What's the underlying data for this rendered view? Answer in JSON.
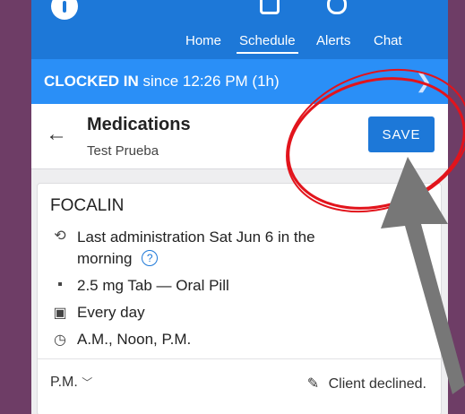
{
  "nav": {
    "tabs": [
      {
        "label": "Home"
      },
      {
        "label": "Schedule"
      },
      {
        "label": "Alerts"
      },
      {
        "label": "Chat"
      }
    ]
  },
  "status_bar": {
    "status": "CLOCKED IN",
    "since": "since 12:26 PM (1h)"
  },
  "header": {
    "title": "Medications",
    "subtitle": "Test Prueba",
    "save_label": "SAVE"
  },
  "medication": {
    "name": "FOCALIN",
    "last_admin": "Last administration Sat Jun 6 in the",
    "last_admin_cont": "morning",
    "dosage": "2.5 mg Tab — Oral Pill",
    "frequency": "Every day",
    "times": "A.M., Noon, P.M.",
    "selected_time": "P.M.",
    "note": "Client declined."
  },
  "colors": {
    "brand_blue": "#1d78d8",
    "status_blue": "#2a8ff7",
    "annotation_red": "#e2141c",
    "arrow_gray": "#777777",
    "frame_purple": "#6e3d66"
  }
}
